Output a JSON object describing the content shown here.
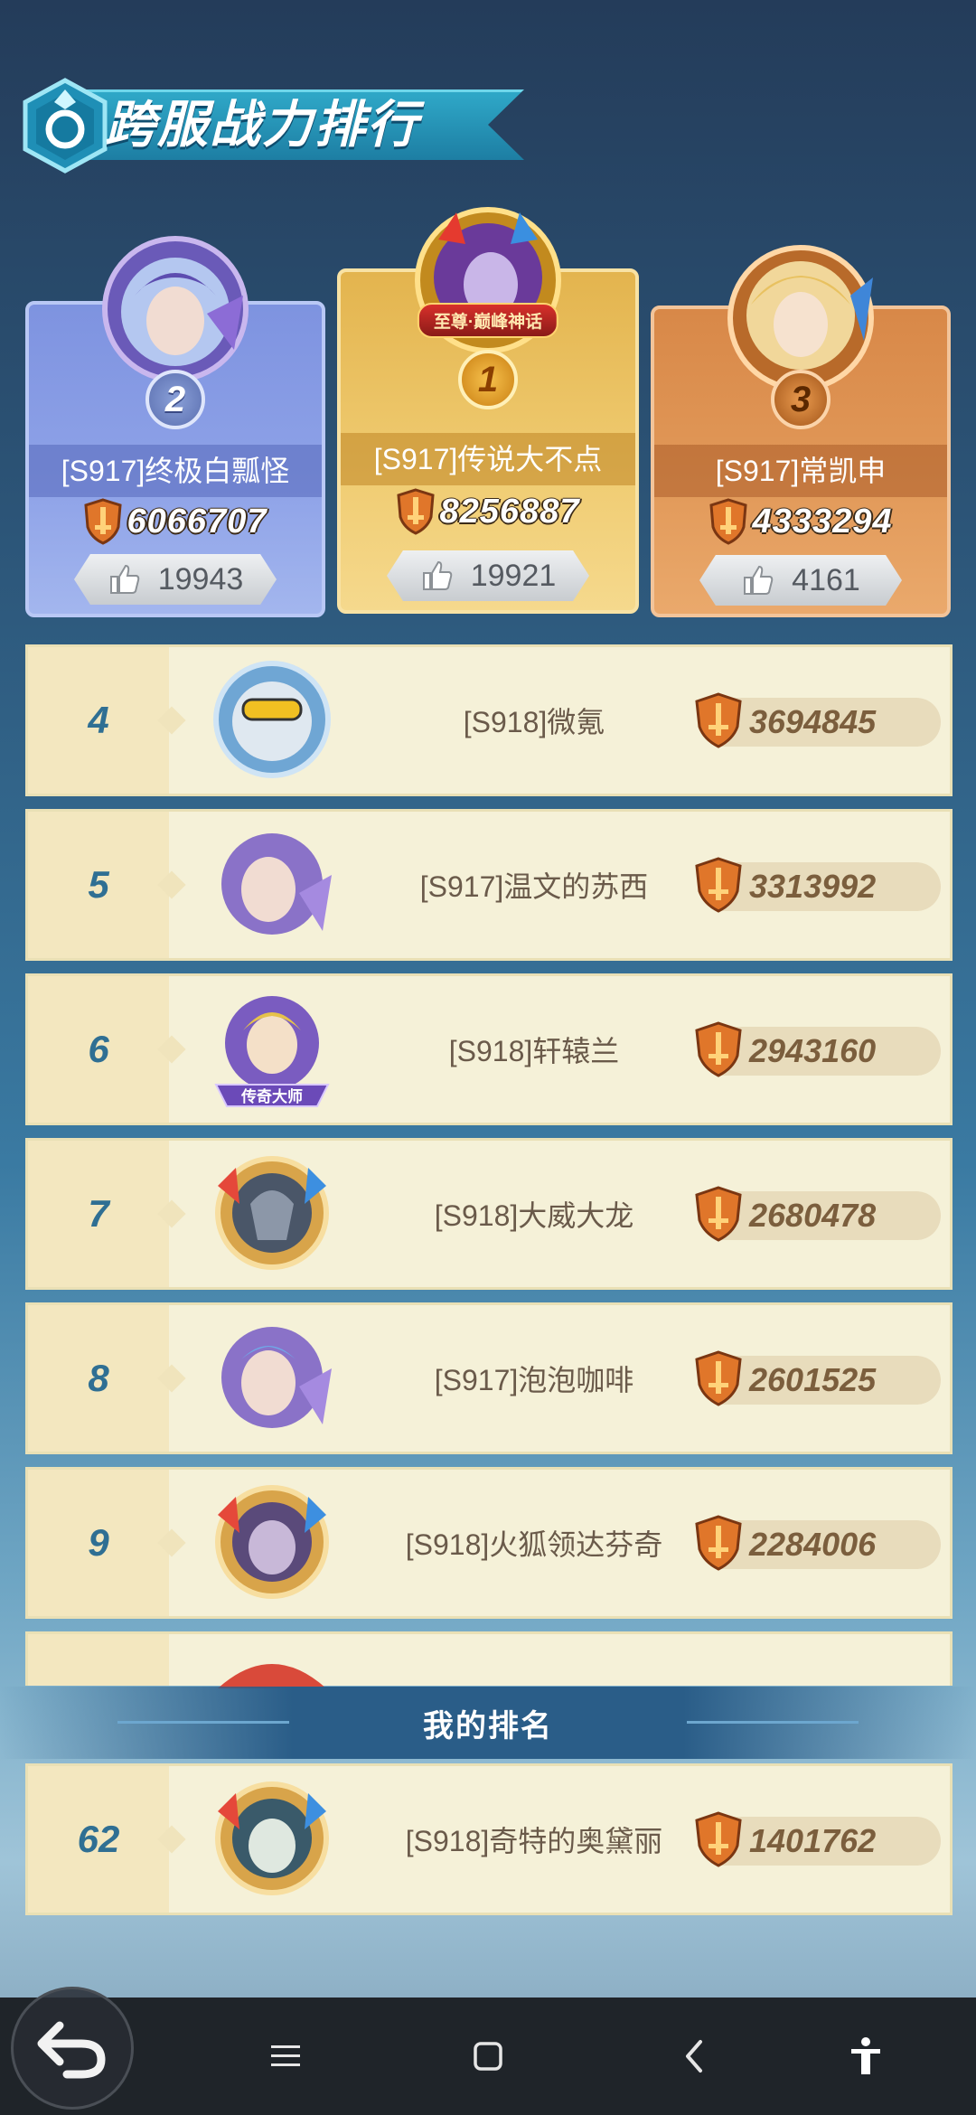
{
  "header": {
    "title": "跨服战力排行"
  },
  "top3": [
    {
      "rank": "2",
      "name": "[S917]终极白瓢怪",
      "power": "6066707",
      "likes": "19943"
    },
    {
      "rank": "1",
      "name": "[S917]传说大不点",
      "power": "8256887",
      "likes": "19921",
      "title_badge": "至尊·巅峰神话"
    },
    {
      "rank": "3",
      "name": "[S917]常凯申",
      "power": "4333294",
      "likes": "4161"
    }
  ],
  "rows": [
    {
      "rank": "4",
      "name": "[S918]微氪",
      "power": "3694845"
    },
    {
      "rank": "5",
      "name": "[S917]温文的苏西",
      "power": "3313992"
    },
    {
      "rank": "6",
      "name": "[S918]轩辕兰",
      "power": "2943160",
      "avatar_badge": "传奇大师"
    },
    {
      "rank": "7",
      "name": "[S918]大威大龙",
      "power": "2680478"
    },
    {
      "rank": "8",
      "name": "[S917]泡泡咖啡",
      "power": "2601525"
    },
    {
      "rank": "9",
      "name": "[S918]火狐领达芬奇",
      "power": "2284006"
    }
  ],
  "my_rank": {
    "header": "我的排名",
    "rank": "62",
    "name": "[S918]奇特的奥黛丽",
    "power": "1401762"
  },
  "nav": {
    "icons": [
      "back-arrow-icon",
      "menu-icon",
      "home-square-icon",
      "back-chevron-icon",
      "accessibility-icon"
    ]
  },
  "colors": {
    "accent": "#2f6f93",
    "gold": "#f0cc72",
    "silver": "#8fa3e8",
    "bronze": "#e29a5a",
    "row_bg": "#f5f1d8"
  }
}
